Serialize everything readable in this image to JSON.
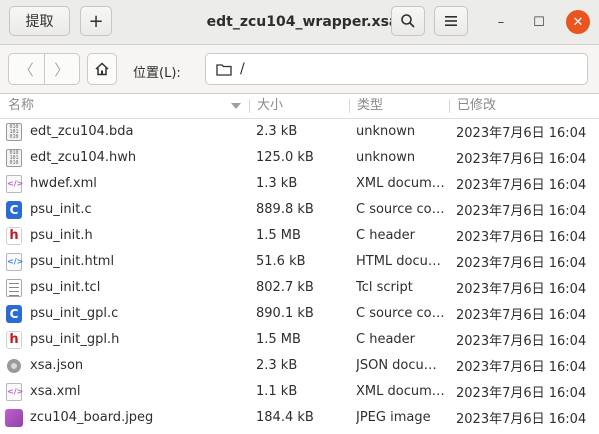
{
  "header": {
    "extract_label": "提取",
    "plus_label": "+",
    "title": "edt_zcu104_wrapper.xsa",
    "search_icon": "search-icon",
    "menu_icon": "hamburger-menu-icon",
    "minimize_glyph": "–",
    "maximize_glyph": "☐",
    "close_glyph": "✕",
    "close_color": "#e95420"
  },
  "location": {
    "back_glyph": "〈",
    "forward_glyph": "〉",
    "label": "位置(L):",
    "path": "/"
  },
  "columns": {
    "name": "名称",
    "size": "大小",
    "type": "类型",
    "modified": "已修改"
  },
  "files": [
    {
      "name": "edt_zcu104.bda",
      "size": "2.3 kB",
      "type": "unknown",
      "modified": "2023年7月6日 16:04",
      "icon": "binary-file-icon"
    },
    {
      "name": "edt_zcu104.hwh",
      "size": "125.0 kB",
      "type": "unknown",
      "modified": "2023年7月6日 16:04",
      "icon": "binary-file-icon"
    },
    {
      "name": "hwdef.xml",
      "size": "1.3 kB",
      "type": "XML document",
      "modified": "2023年7月6日 16:04",
      "icon": "xml-file-icon"
    },
    {
      "name": "psu_init.c",
      "size": "889.8 kB",
      "type": "C source code",
      "modified": "2023年7月6日 16:04",
      "icon": "c-source-icon"
    },
    {
      "name": "psu_init.h",
      "size": "1.5 MB",
      "type": "C header",
      "modified": "2023年7月6日 16:04",
      "icon": "c-header-icon"
    },
    {
      "name": "psu_init.html",
      "size": "51.6 kB",
      "type": "HTML document",
      "modified": "2023年7月6日 16:04",
      "icon": "html-file-icon"
    },
    {
      "name": "psu_init.tcl",
      "size": "802.7 kB",
      "type": "Tcl script",
      "modified": "2023年7月6日 16:04",
      "icon": "text-file-icon"
    },
    {
      "name": "psu_init_gpl.c",
      "size": "890.1 kB",
      "type": "C source code",
      "modified": "2023年7月6日 16:04",
      "icon": "c-source-icon"
    },
    {
      "name": "psu_init_gpl.h",
      "size": "1.5 MB",
      "type": "C header",
      "modified": "2023年7月6日 16:04",
      "icon": "c-header-icon"
    },
    {
      "name": "xsa.json",
      "size": "2.3 kB",
      "type": "JSON document",
      "modified": "2023年7月6日 16:04",
      "icon": "json-file-icon"
    },
    {
      "name": "xsa.xml",
      "size": "1.1 kB",
      "type": "XML document",
      "modified": "2023年7月6日 16:04",
      "icon": "xml-file-icon"
    },
    {
      "name": "zcu104_board.jpeg",
      "size": "184.4 kB",
      "type": "JPEG image",
      "modified": "2023年7月6日 16:04",
      "icon": "image-file-icon"
    }
  ]
}
